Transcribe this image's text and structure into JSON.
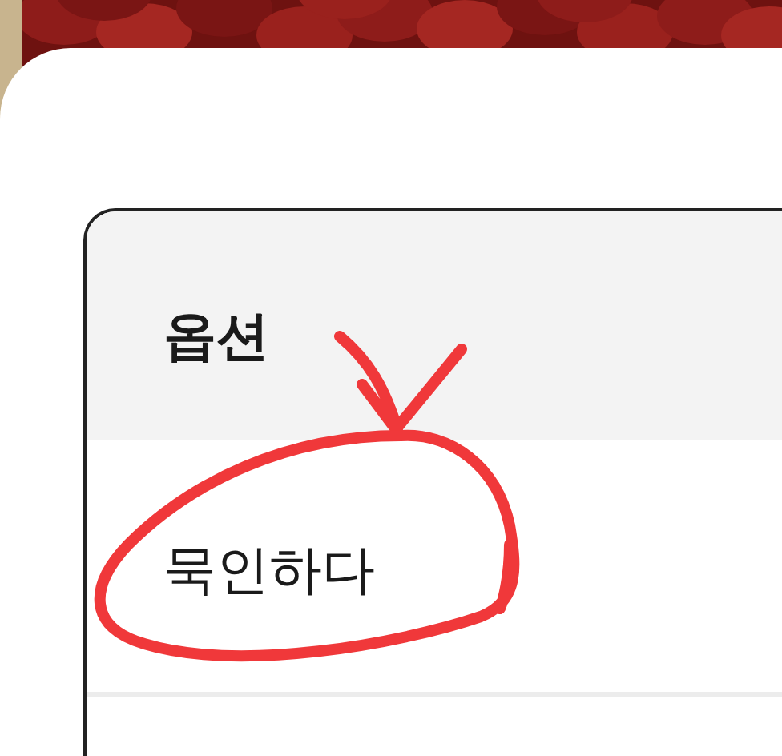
{
  "table": {
    "columns": [
      "옵션"
    ],
    "rows": [
      {
        "cells": [
          "묵인하다"
        ]
      }
    ]
  }
}
